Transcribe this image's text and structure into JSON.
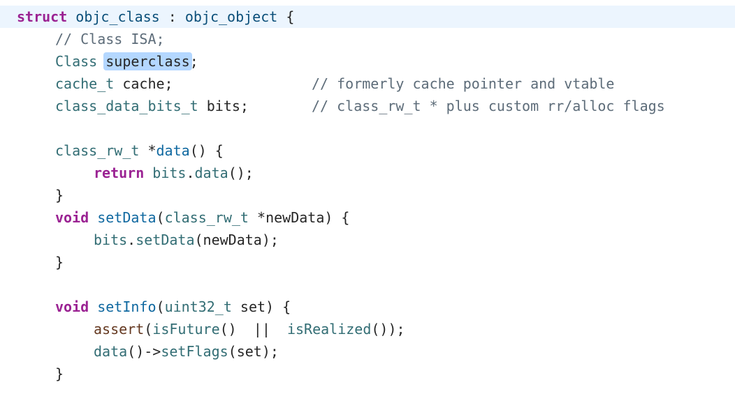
{
  "lines": {
    "l1": {
      "kw": "struct",
      "name": "objc_class",
      "colon": " : ",
      "base": "objc_object",
      "brace": " {"
    },
    "l2": {
      "comment": "// Class ISA;"
    },
    "l3": {
      "type": "Class",
      "sel": "superclass",
      "semi": ";"
    },
    "l4": {
      "type": "cache_t",
      "rest": " cache;",
      "comment": "// formerly cache pointer and vtable"
    },
    "l5": {
      "type": "class_data_bits_t",
      "rest": " bits;",
      "comment": "// class_rw_t * plus custom rr/alloc flags"
    },
    "l7": {
      "type": "class_rw_t",
      "star": " *",
      "fn": "data",
      "rest": "() {"
    },
    "l8": {
      "kw": "return",
      "obj": " bits",
      "dot": ".",
      "fn": "data",
      "rest": "();"
    },
    "l9": {
      "brace": "}"
    },
    "l10": {
      "kw": "void",
      "fn": "setData",
      "open": "(",
      "type": "class_rw_t",
      "rest": " *newData) {"
    },
    "l11": {
      "obj": "bits",
      "dot": ".",
      "fn": "setData",
      "rest": "(newData);"
    },
    "l12": {
      "brace": "}"
    },
    "l14": {
      "kw": "void",
      "fn": "setInfo",
      "open": "(",
      "type": "uint32_t",
      "rest": " set) {"
    },
    "l15": {
      "macro": "assert",
      "open": "(",
      "fn1": "isFuture",
      "mid": "()  ||  ",
      "fn2": "isRealized",
      "rest": "());"
    },
    "l16": {
      "fn1": "data",
      "mid": "()->",
      "fn2": "setFlags",
      "rest": "(set);"
    },
    "l17": {
      "brace": "}"
    }
  }
}
